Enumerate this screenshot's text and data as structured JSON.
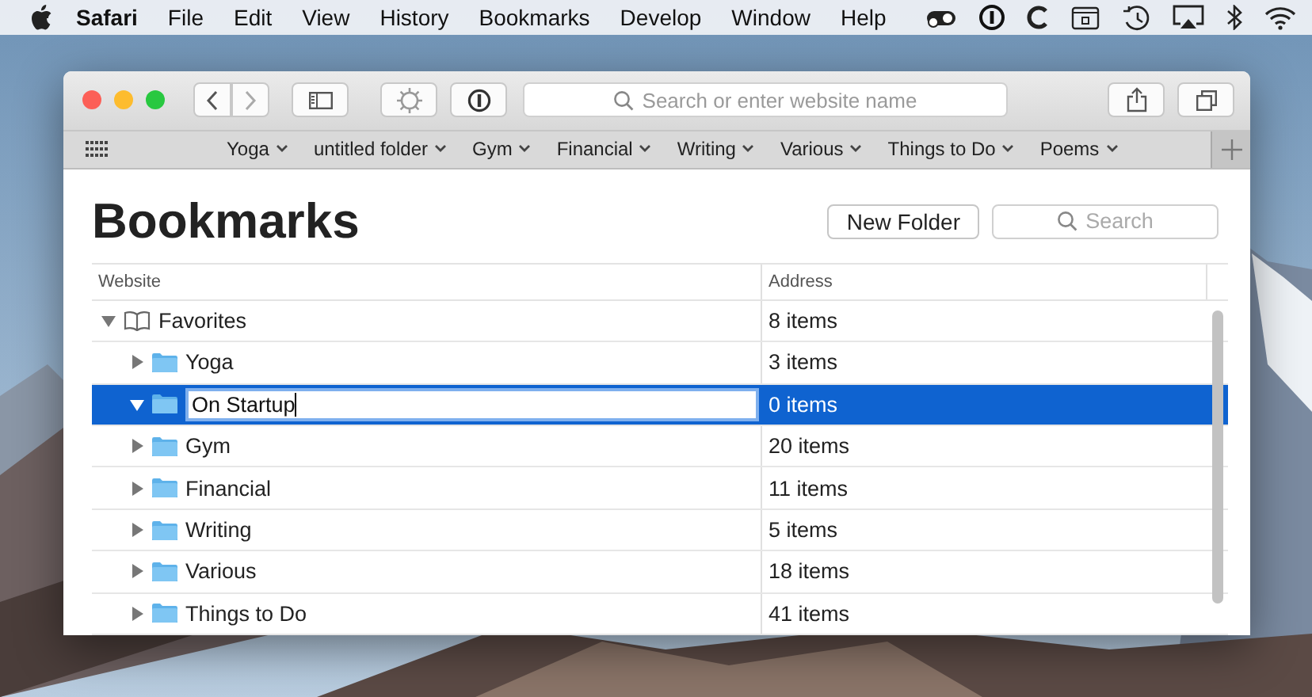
{
  "menubar": {
    "app": "Safari",
    "items": [
      "File",
      "Edit",
      "View",
      "History",
      "Bookmarks",
      "Develop",
      "Window",
      "Help"
    ]
  },
  "toolbar": {
    "address_placeholder": "Search or enter website name"
  },
  "bookmarks_bar": [
    "Yoga",
    "untitled folder",
    "Gym",
    "Financial",
    "Writing",
    "Various",
    "Things to Do",
    "Poems"
  ],
  "page": {
    "title": "Bookmarks",
    "new_folder_button": "New Folder",
    "search_placeholder": "Search"
  },
  "table": {
    "columns": [
      "Website",
      "Address"
    ],
    "rows": [
      {
        "kind": "collection",
        "name": "Favorites",
        "address": "8 items",
        "expanded": true,
        "selected": false,
        "editing": false,
        "children": [
          {
            "kind": "folder",
            "name": "Yoga",
            "address": "3 items",
            "expanded": false,
            "selected": false,
            "editing": false
          },
          {
            "kind": "folder",
            "name": "On Startup",
            "address": "0 items",
            "expanded": true,
            "selected": true,
            "editing": true
          },
          {
            "kind": "folder",
            "name": "Gym",
            "address": "20 items",
            "expanded": false,
            "selected": false,
            "editing": false
          },
          {
            "kind": "folder",
            "name": "Financial",
            "address": "11 items",
            "expanded": false,
            "selected": false,
            "editing": false
          },
          {
            "kind": "folder",
            "name": "Writing",
            "address": "5 items",
            "expanded": false,
            "selected": false,
            "editing": false
          },
          {
            "kind": "folder",
            "name": "Various",
            "address": "18 items",
            "expanded": false,
            "selected": false,
            "editing": false
          },
          {
            "kind": "folder",
            "name": "Things to Do",
            "address": "41 items",
            "expanded": false,
            "selected": false,
            "editing": false
          }
        ]
      }
    ]
  }
}
